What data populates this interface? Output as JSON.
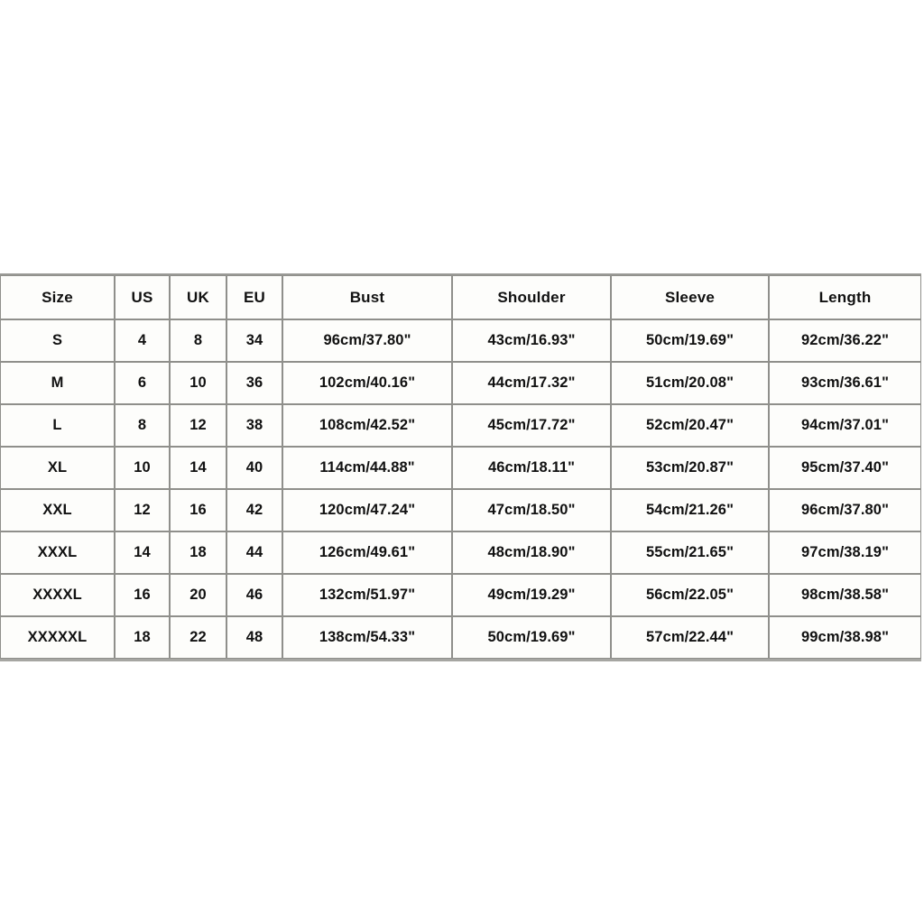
{
  "table": {
    "columns": [
      {
        "key": "size",
        "label": "Size",
        "type": "size"
      },
      {
        "key": "us",
        "label": "US",
        "type": "num"
      },
      {
        "key": "uk",
        "label": "UK",
        "type": "num"
      },
      {
        "key": "eu",
        "label": "EU",
        "type": "num"
      },
      {
        "key": "bust",
        "label": "Bust",
        "type": "meas"
      },
      {
        "key": "shoulder",
        "label": "Shoulder",
        "type": "meas"
      },
      {
        "key": "sleeve",
        "label": "Sleeve",
        "type": "meas"
      },
      {
        "key": "length",
        "label": "Length",
        "type": "meas"
      }
    ],
    "rows": [
      {
        "size": "S",
        "us": "4",
        "uk": "8",
        "eu": "34",
        "bust": "96cm/37.80\"",
        "shoulder": "43cm/16.93\"",
        "sleeve": "50cm/19.69\"",
        "length": "92cm/36.22\""
      },
      {
        "size": "M",
        "us": "6",
        "uk": "10",
        "eu": "36",
        "bust": "102cm/40.16\"",
        "shoulder": "44cm/17.32\"",
        "sleeve": "51cm/20.08\"",
        "length": "93cm/36.61\""
      },
      {
        "size": "L",
        "us": "8",
        "uk": "12",
        "eu": "38",
        "bust": "108cm/42.52\"",
        "shoulder": "45cm/17.72\"",
        "sleeve": "52cm/20.47\"",
        "length": "94cm/37.01\""
      },
      {
        "size": "XL",
        "us": "10",
        "uk": "14",
        "eu": "40",
        "bust": "114cm/44.88\"",
        "shoulder": "46cm/18.11\"",
        "sleeve": "53cm/20.87\"",
        "length": "95cm/37.40\""
      },
      {
        "size": "XXL",
        "us": "12",
        "uk": "16",
        "eu": "42",
        "bust": "120cm/47.24\"",
        "shoulder": "47cm/18.50\"",
        "sleeve": "54cm/21.26\"",
        "length": "96cm/37.80\""
      },
      {
        "size": "XXXL",
        "us": "14",
        "uk": "18",
        "eu": "44",
        "bust": "126cm/49.61\"",
        "shoulder": "48cm/18.90\"",
        "sleeve": "55cm/21.65\"",
        "length": "97cm/38.19\""
      },
      {
        "size": "XXXXL",
        "us": "16",
        "uk": "20",
        "eu": "46",
        "bust": "132cm/51.97\"",
        "shoulder": "49cm/19.29\"",
        "sleeve": "56cm/22.05\"",
        "length": "98cm/38.58\""
      },
      {
        "size": "XXXXXL",
        "us": "18",
        "uk": "22",
        "eu": "48",
        "bust": "138cm/54.33\"",
        "shoulder": "50cm/19.69\"",
        "sleeve": "57cm/22.44\"",
        "length": "99cm/38.98\""
      }
    ]
  },
  "colors": {
    "page_background": "#ffffff",
    "cell_background": "#fdfdfb",
    "border": "#8f8f8b",
    "outer_border": "#9a9a96",
    "text": "#111111"
  }
}
